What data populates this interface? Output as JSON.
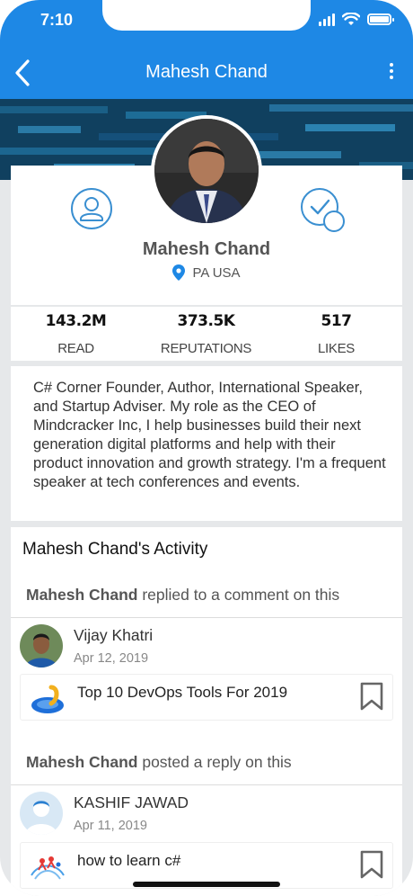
{
  "status": {
    "time": "7:10"
  },
  "nav": {
    "title": "Mahesh Chand"
  },
  "profile": {
    "name": "Mahesh Chand",
    "location": "PA USA"
  },
  "stats": [
    {
      "value": "143.2M",
      "label": "READ"
    },
    {
      "value": "373.5K",
      "label": "REPUTATIONS"
    },
    {
      "value": "517",
      "label": "LIKES"
    }
  ],
  "bio": "C# Corner Founder, Author, International Speaker, and Startup Adviser. My role as the CEO of Mindcracker Inc, I help businesses build their next generation digital platforms and help with their product innovation and growth strategy. I'm a frequent speaker at tech conferences and events.",
  "activity": {
    "title": "Mahesh Chand's Activity",
    "items": [
      {
        "actor": "Mahesh Chand",
        "action": " replied to a comment on this",
        "user": "Vijay Khatri",
        "date": "Apr 12, 2019",
        "article": "Top 10 DevOps Tools For 2019"
      },
      {
        "actor": "Mahesh Chand",
        "action": " posted a reply on this",
        "user": "KASHIF JAWAD",
        "date": "Apr 11, 2019",
        "article": "how to learn c#"
      }
    ]
  },
  "colors": {
    "primary": "#1e88e5",
    "icon_blue": "#3a8fd1"
  }
}
